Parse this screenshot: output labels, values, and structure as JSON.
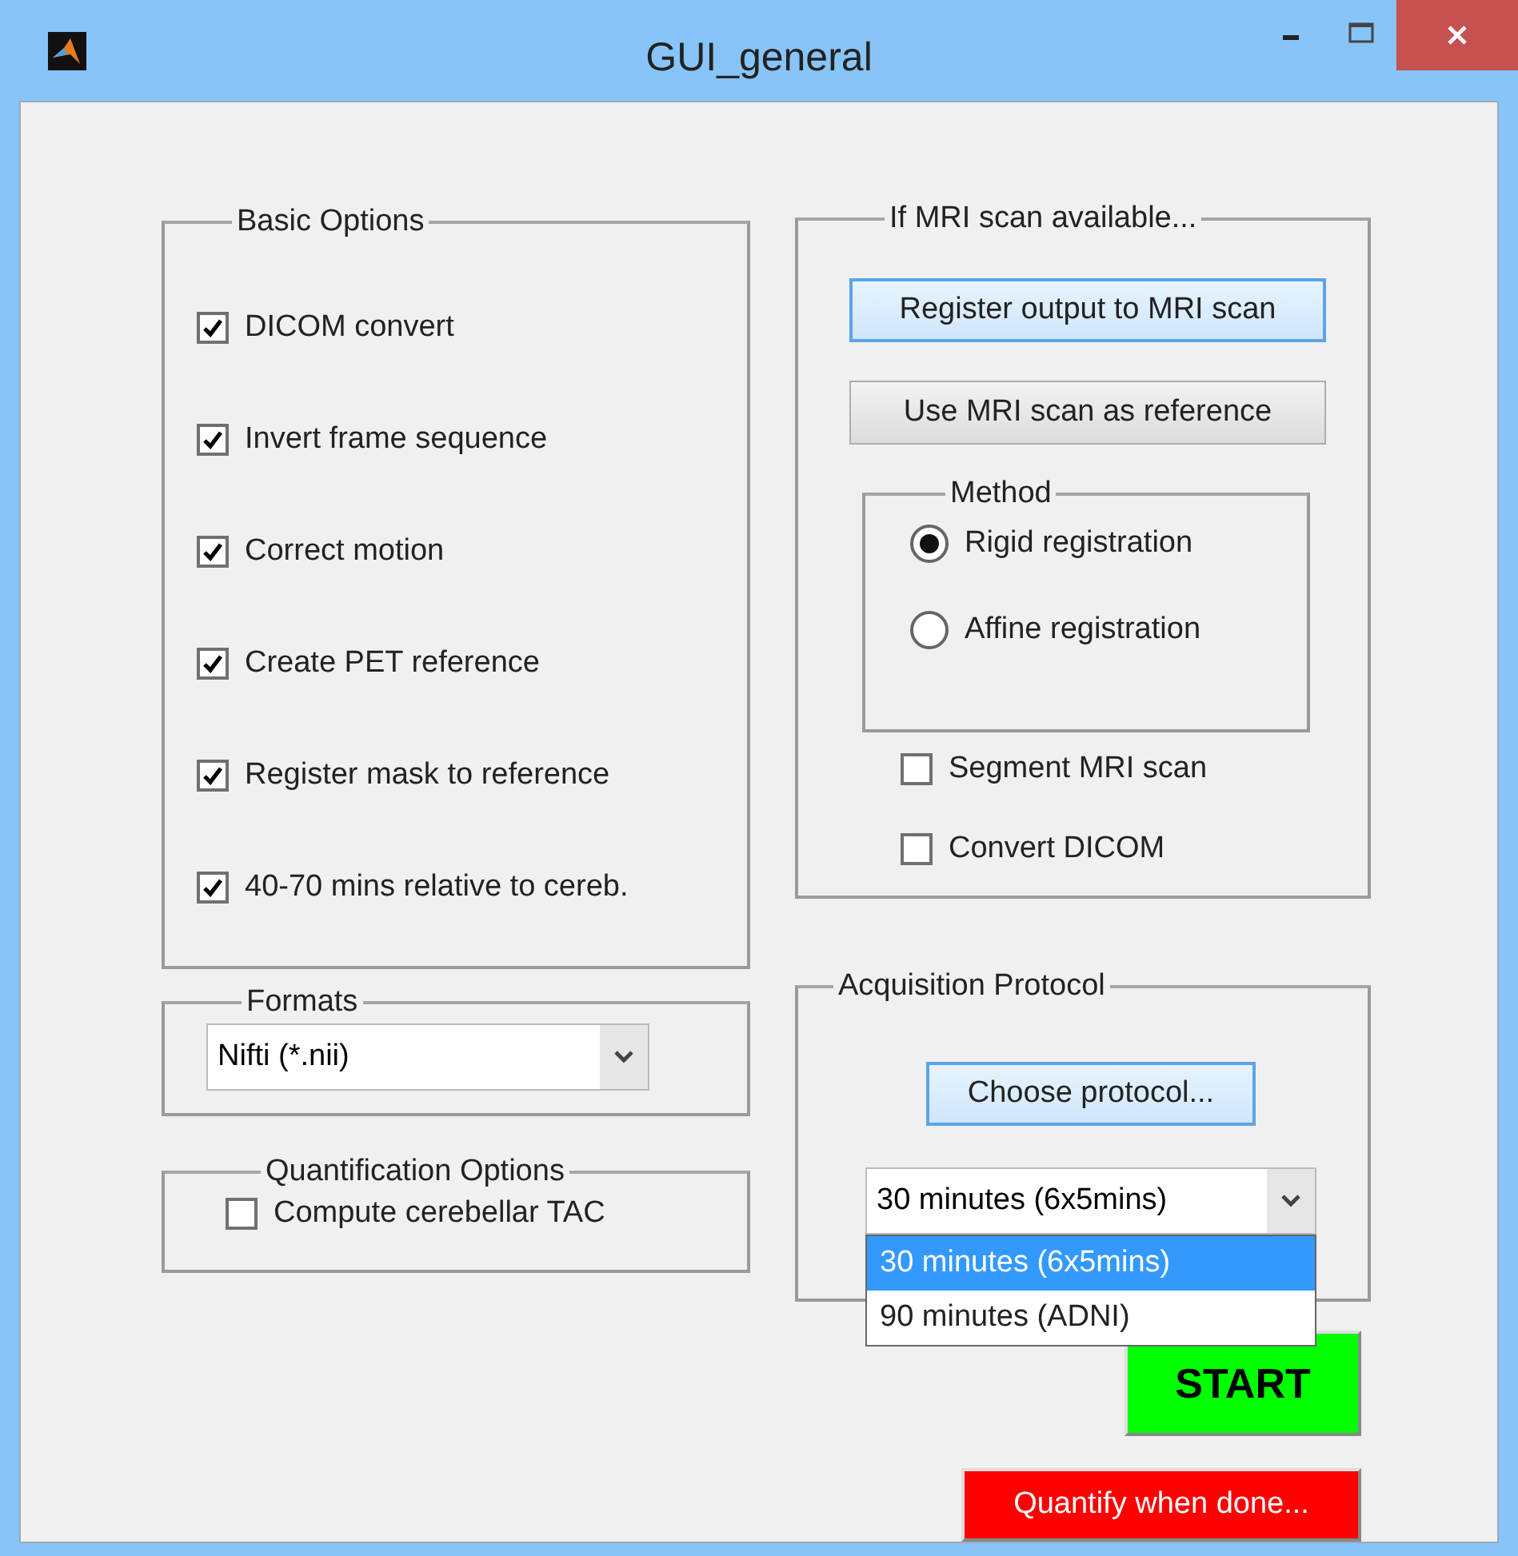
{
  "window": {
    "title": "GUI_general"
  },
  "basic_options": {
    "title": "Basic Options",
    "items": [
      {
        "label": "DICOM convert",
        "checked": true
      },
      {
        "label": "Invert frame sequence",
        "checked": true
      },
      {
        "label": "Correct motion",
        "checked": true
      },
      {
        "label": "Create PET reference",
        "checked": true
      },
      {
        "label": "Register mask to reference",
        "checked": true
      },
      {
        "label": "40-70 mins relative to cereb.",
        "checked": true
      }
    ]
  },
  "formats": {
    "title": "Formats",
    "value": "Nifti (*.nii)"
  },
  "quantification": {
    "title": "Quantification Options",
    "items": [
      {
        "label": "Compute cerebellar TAC",
        "checked": false
      }
    ]
  },
  "mri": {
    "title": "If MRI scan available...",
    "buttons": [
      {
        "label": "Register output to MRI scan",
        "highlighted": true
      },
      {
        "label": "Use MRI scan as reference",
        "highlighted": false
      }
    ],
    "method": {
      "title": "Method",
      "options": [
        {
          "label": "Rigid registration",
          "selected": true
        },
        {
          "label": "Affine registration",
          "selected": false
        }
      ]
    },
    "items": [
      {
        "label": "Segment MRI scan",
        "checked": false
      },
      {
        "label": "Convert DICOM",
        "checked": false
      }
    ]
  },
  "acquisition": {
    "title": "Acquisition Protocol",
    "button": {
      "label": "Choose protocol...",
      "highlighted": true
    },
    "dropdown": {
      "value": "30 minutes (6x5mins)",
      "expanded": true,
      "options": [
        {
          "label": "30 minutes (6x5mins)",
          "selected": true
        },
        {
          "label": "90 minutes (ADNI)",
          "selected": false
        }
      ]
    }
  },
  "actions": [
    {
      "label": "START",
      "kind": "primary",
      "color": "#00ff00"
    },
    {
      "label": "Quantify when done...",
      "kind": "secondary",
      "color": "#ff0000"
    }
  ]
}
